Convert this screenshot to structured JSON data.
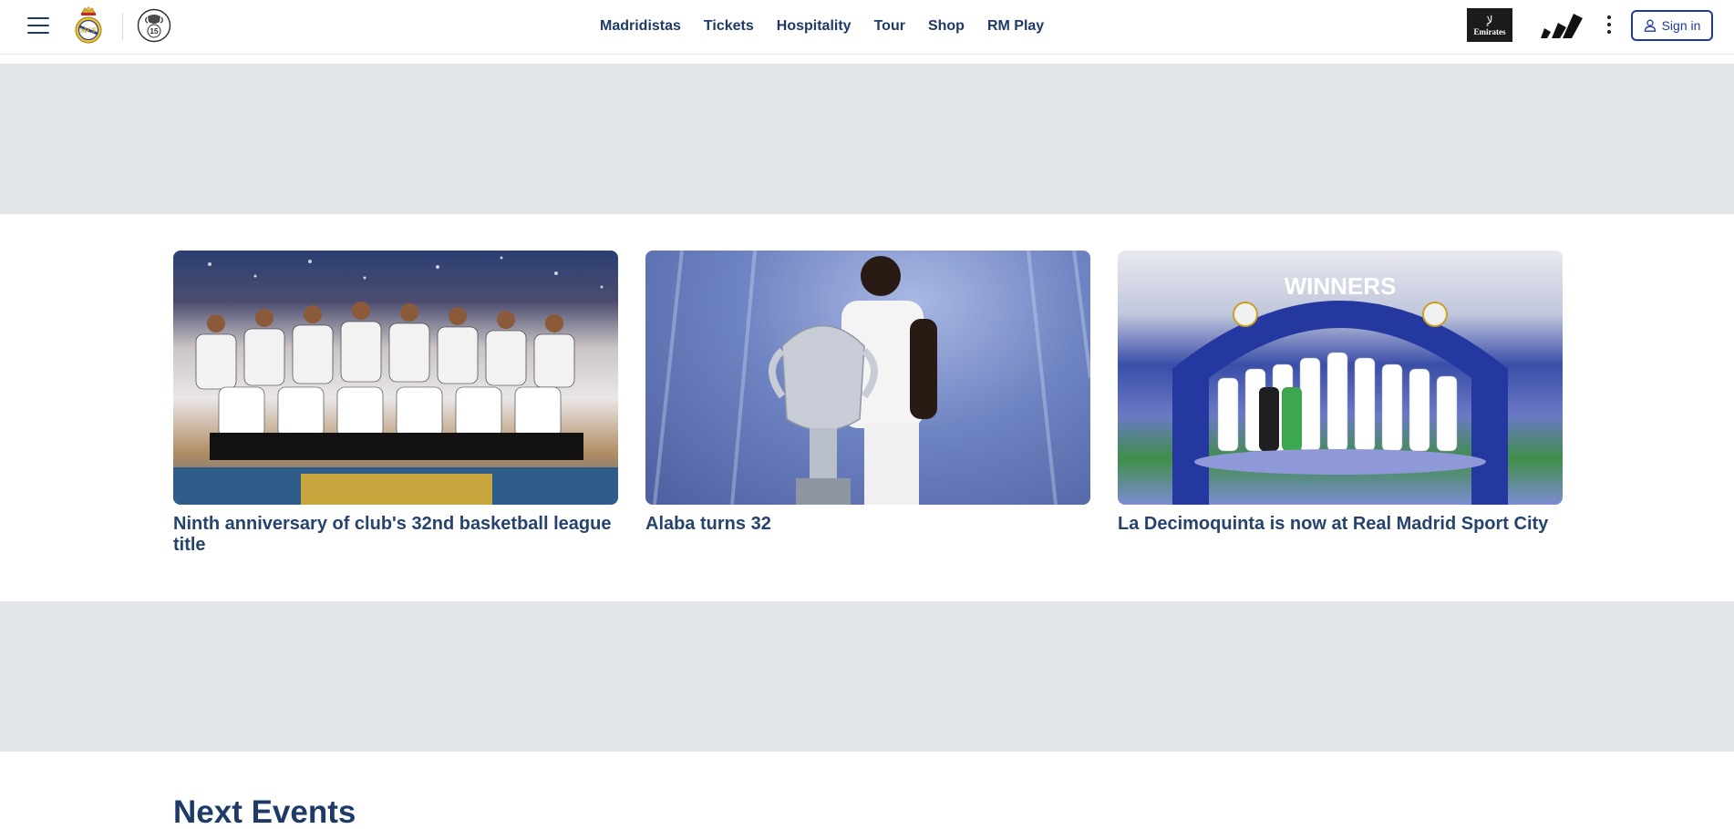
{
  "header": {
    "nav": [
      "Madridistas",
      "Tickets",
      "Hospitality",
      "Tour",
      "Shop",
      "RM Play"
    ],
    "ucl_count": "15",
    "sponsor_emirates": "Emirates",
    "signin_label": "Sign in",
    "icons": [
      "hamburger-menu-icon",
      "real-madrid-crest-icon",
      "ucl-15-badge-icon",
      "emirates-logo-icon",
      "adidas-logo-icon",
      "more-vertical-icon",
      "user-icon"
    ]
  },
  "news": [
    {
      "title": "Ninth anniversary of club's 32nd basketball league title"
    },
    {
      "title": "Alaba turns 32"
    },
    {
      "title": "La Decimoquinta is now at Real Madrid Sport City"
    }
  ],
  "news_images": {
    "ucl_arch_text": "WINNERS"
  },
  "sections": {
    "next_events_title": "Next Events"
  },
  "colors": {
    "brand_navy": "#1e3a66",
    "signin_blue": "#1e3aa8",
    "ad_placeholder": "#e2e5e9"
  }
}
